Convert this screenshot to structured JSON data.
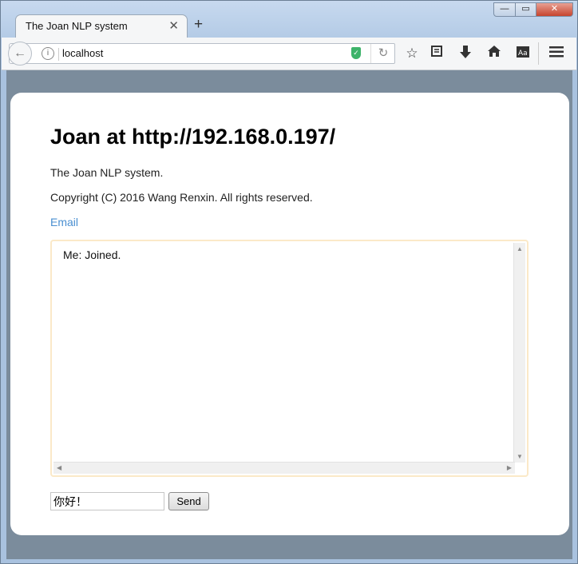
{
  "browser": {
    "tab_title": "The Joan NLP system",
    "tab_close_glyph": "✕",
    "new_tab_glyph": "+",
    "url": "localhost",
    "window_controls": {
      "minimize": "—",
      "maximize": "▭",
      "close": "✕"
    },
    "toolbar_icons": [
      "bookmark-star-icon",
      "reading-list-icon",
      "download-icon",
      "home-icon",
      "reader-view-icon",
      "hamburger-menu-icon"
    ]
  },
  "page": {
    "title": "Joan at http://192.168.0.197/",
    "description": "The Joan NLP system.",
    "copyright": "Copyright (C) 2016 Wang Renxin. All rights reserved.",
    "email_link": "Email"
  },
  "chat": {
    "log": "Me: Joined.",
    "input_value": "你好！",
    "send_label": "Send"
  }
}
